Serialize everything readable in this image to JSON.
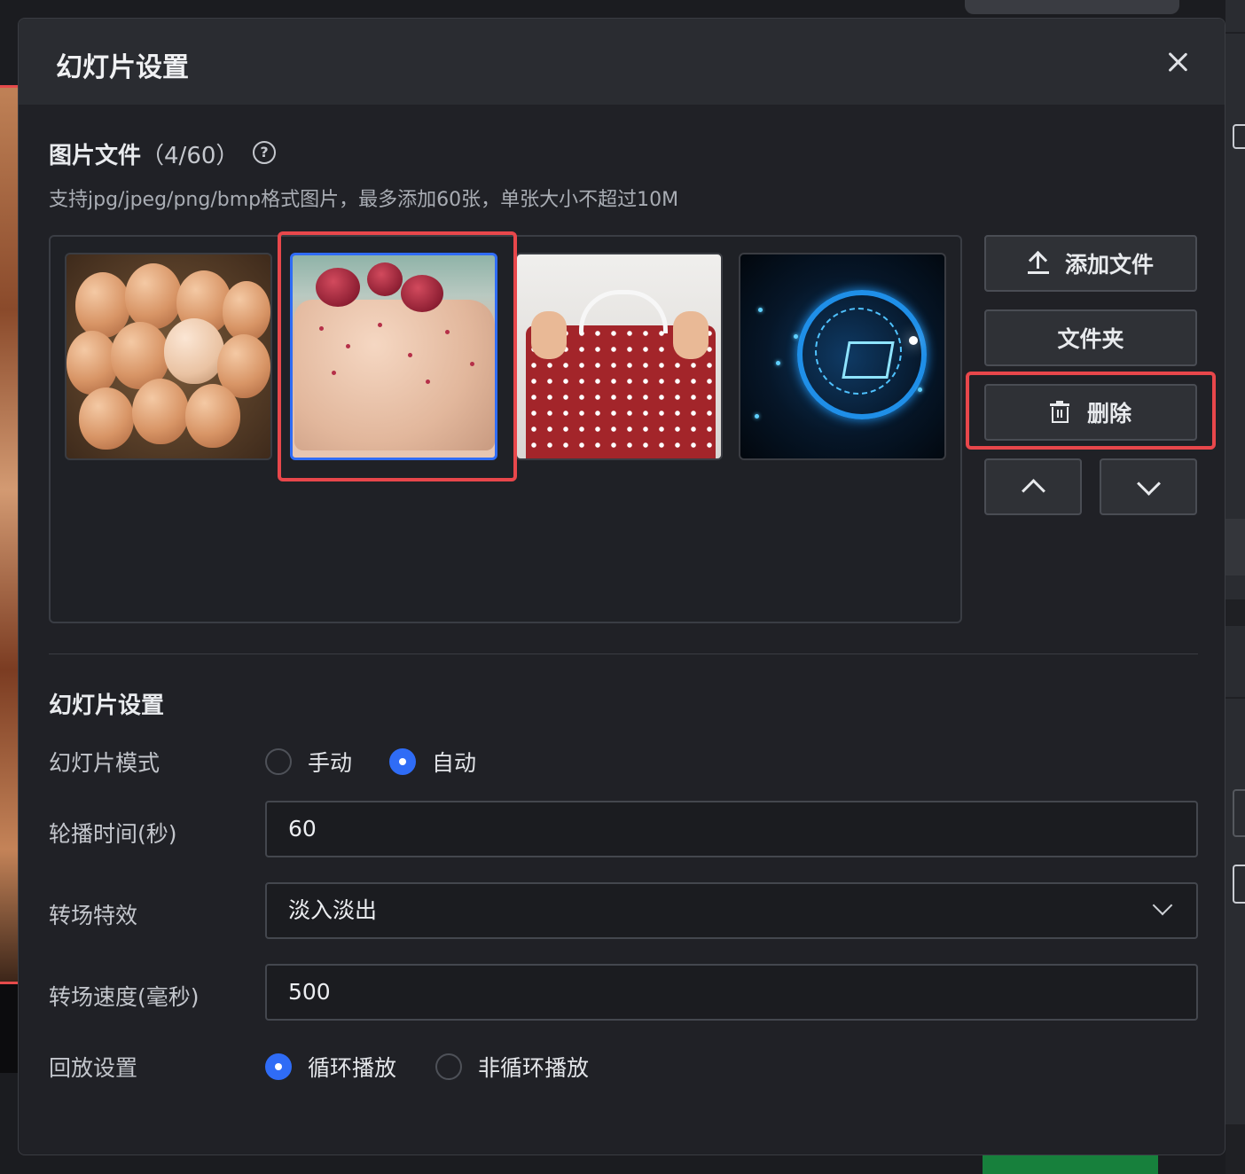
{
  "modal": {
    "title": "幻灯片设置",
    "close_icon": "close-icon"
  },
  "files": {
    "title": "图片文件",
    "count": "（4/60）",
    "hint": "支持jpg/jpeg/png/bmp格式图片，最多添加60张，单张大小不超过10M",
    "images": [
      {
        "subject": "eggs in basket",
        "selected": false
      },
      {
        "subject": "rose cake",
        "selected": true
      },
      {
        "subject": "red polka dot shirt",
        "selected": false
      },
      {
        "subject": "tech shopping cart",
        "selected": false
      }
    ]
  },
  "actions": {
    "add_file": "添加文件",
    "folder": "文件夹",
    "delete": "删除",
    "move_up_icon": "chevron-up-icon",
    "move_down_icon": "chevron-down-icon"
  },
  "settings": {
    "title": "幻灯片设置",
    "mode_label": "幻灯片模式",
    "mode_options": [
      "手动",
      "自动"
    ],
    "mode_selected": "自动",
    "interval_label": "轮播时间(秒)",
    "interval_value": "60",
    "transition_label": "转场特效",
    "transition_value": "淡入淡出",
    "speed_label": "转场速度(毫秒)",
    "speed_value": "500",
    "playback_label": "回放设置",
    "playback_options": [
      "循环播放",
      "非循环播放"
    ],
    "playback_selected": "循环播放"
  },
  "colors": {
    "accent": "#2f6cf6",
    "highlight": "#e8474b",
    "background": "#202126"
  }
}
